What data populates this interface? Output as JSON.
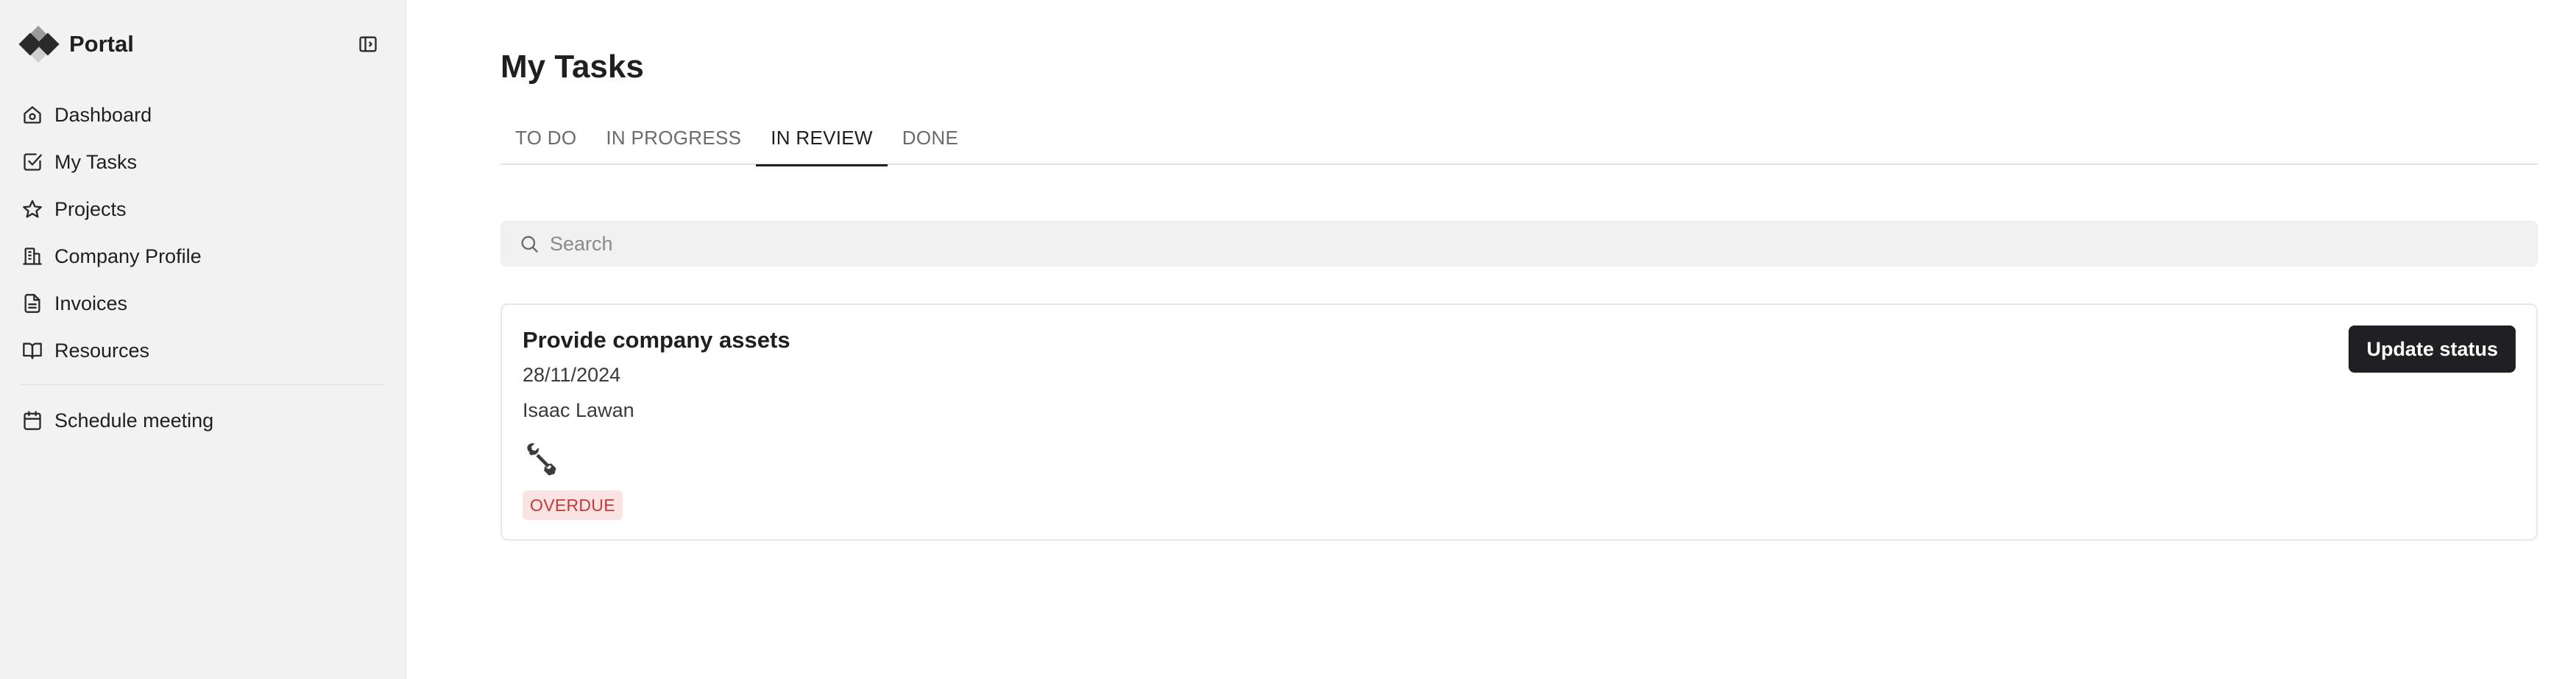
{
  "sidebar": {
    "brand": "Portal",
    "items": [
      {
        "label": "Dashboard",
        "icon": "home-icon"
      },
      {
        "label": "My Tasks",
        "icon": "checkbox-icon"
      },
      {
        "label": "Projects",
        "icon": "star-icon"
      },
      {
        "label": "Company Profile",
        "icon": "building-icon"
      },
      {
        "label": "Invoices",
        "icon": "document-icon"
      },
      {
        "label": "Resources",
        "icon": "book-icon"
      }
    ],
    "secondary_items": [
      {
        "label": "Schedule meeting",
        "icon": "calendar-icon"
      }
    ]
  },
  "main": {
    "title": "My Tasks",
    "tabs": [
      {
        "label": "TO DO",
        "active": false
      },
      {
        "label": "IN PROGRESS",
        "active": false
      },
      {
        "label": "IN REVIEW",
        "active": true
      },
      {
        "label": "DONE",
        "active": false
      }
    ],
    "search": {
      "placeholder": "Search",
      "value": ""
    },
    "tasks": [
      {
        "title": "Provide company assets",
        "date": "28/11/2024",
        "assignee": "Isaac Lawan",
        "icon": "wrench-icon",
        "badge": "OVERDUE",
        "action_label": "Update status"
      }
    ]
  },
  "colors": {
    "sidebar_bg": "#f2f2f2",
    "primary_button": "#1f1f24",
    "overdue_bg": "#fbe3e3",
    "overdue_text": "#c53a3a"
  }
}
